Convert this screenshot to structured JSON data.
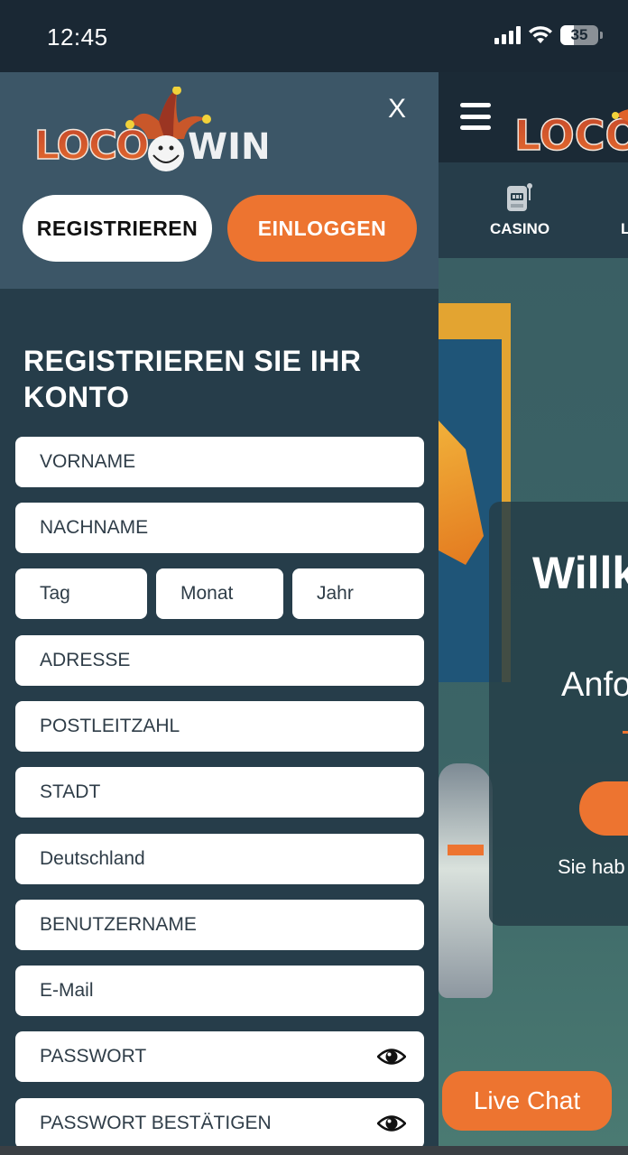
{
  "status_bar": {
    "time": "12:45",
    "battery_level": "35",
    "icons": [
      "cellular-signal-icon",
      "wifi-icon",
      "battery-icon"
    ]
  },
  "drawer": {
    "brand": {
      "logo_left": "LOCO",
      "logo_right": "WIN"
    },
    "close_label": "X",
    "register_button": "REGISTRIEREN",
    "login_button": "EINLOGGEN",
    "form_title": "REGISTRIEREN SIE IHR KONTO",
    "fields": {
      "first_name": "VORNAME",
      "last_name": "NACHNAME",
      "day": "Tag",
      "month": "Monat",
      "year": "Jahr",
      "address": "ADRESSE",
      "postal_code": "POSTLEITZAHL",
      "city": "STADT",
      "country": "Deutschland",
      "username": "BENUTZERNAME",
      "email": "E-Mail",
      "password": "PASSWORT",
      "password_confirm": "PASSWORT BESTÄTIGEN"
    }
  },
  "background_page": {
    "nav": {
      "casino": "CASINO",
      "partial_next": "L"
    },
    "hero": {
      "welcome_partial": "Willk",
      "subtitle_partial": "Anfo",
      "note_partial": "Sie hab"
    },
    "live_chat": "Live Chat"
  },
  "colors": {
    "accent_orange": "#ed7430",
    "drawer_header": "#3c5667",
    "drawer_body": "#263d4a",
    "status_bar": "#1a2834"
  }
}
